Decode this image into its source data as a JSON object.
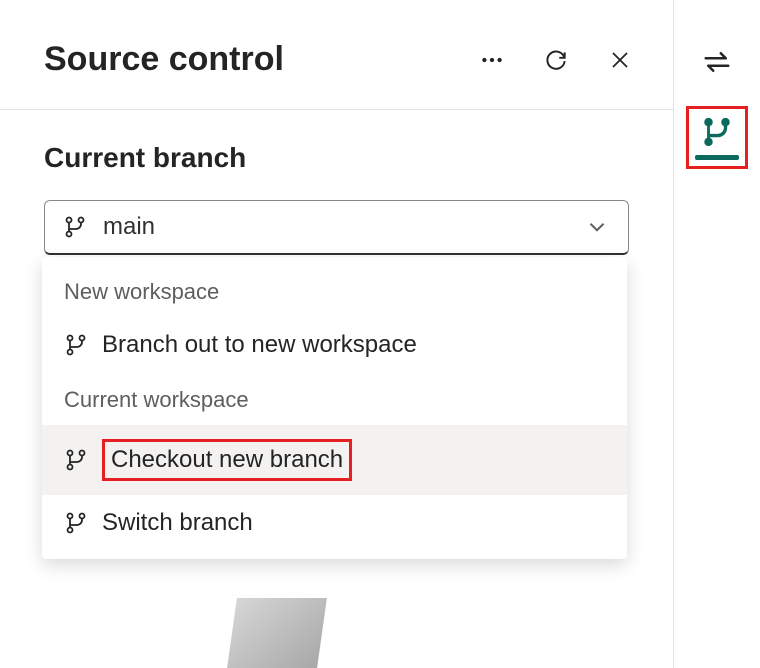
{
  "header": {
    "title": "Source control"
  },
  "section": {
    "title": "Current branch"
  },
  "dropdown": {
    "selected": "main",
    "groups": [
      {
        "label": "New workspace",
        "items": [
          {
            "label": "Branch out to new workspace"
          }
        ]
      },
      {
        "label": "Current workspace",
        "items": [
          {
            "label": "Checkout new branch",
            "highlighted": true
          },
          {
            "label": "Switch branch"
          }
        ]
      }
    ]
  }
}
